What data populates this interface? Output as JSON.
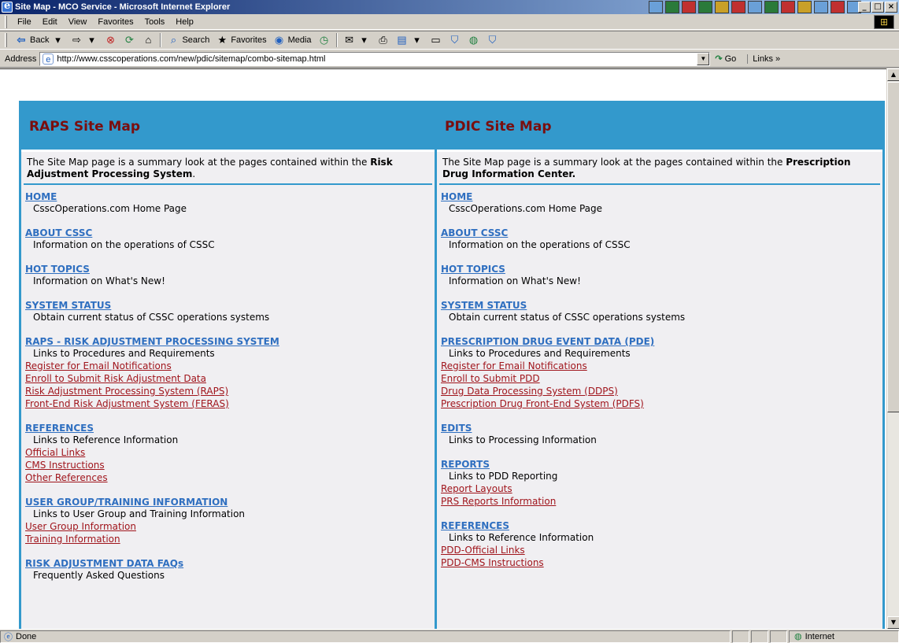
{
  "window": {
    "title": "Site Map - MCO Service - Microsoft Internet Explorer",
    "buttons": [
      "_",
      "□",
      "×"
    ]
  },
  "menu": [
    "File",
    "Edit",
    "View",
    "Favorites",
    "Tools",
    "Help"
  ],
  "toolbar": {
    "back": "Back",
    "search": "Search",
    "favorites": "Favorites",
    "media": "Media"
  },
  "address": {
    "label": "Address",
    "url": "http://www.csscoperations.com/new/pdic/sitemap/combo-sitemap.html",
    "go": "Go",
    "links": "Links"
  },
  "left": {
    "title": "RAPS Site Map",
    "intro_prefix": "The Site Map page is a summary look at the pages contained within the ",
    "intro_bold": "Risk Adjustment Processing System",
    "intro_suffix": ".",
    "sections": [
      {
        "title": "HOME",
        "desc": "CsscOperations.com Home Page",
        "links": []
      },
      {
        "title": "ABOUT CSSC",
        "desc": "Information on the operations of CSSC",
        "links": []
      },
      {
        "title": "HOT TOPICS",
        "desc": "Information on What's New!",
        "links": []
      },
      {
        "title": "SYSTEM STATUS",
        "desc": "Obtain current status of CSSC operations systems",
        "links": []
      },
      {
        "title": "RAPS - RISK ADJUSTMENT PROCESSING SYSTEM",
        "desc": "Links to Procedures and Requirements",
        "links": [
          "Register for Email Notifications",
          "Enroll to Submit Risk Adjustment Data",
          "Risk Adjustment Processing System (RAPS)",
          "Front-End Risk Adjustment System (FERAS)"
        ]
      },
      {
        "title": "REFERENCES",
        "desc": "Links to Reference Information",
        "links": [
          "Official Links",
          "CMS Instructions",
          "Other References"
        ]
      },
      {
        "title": "USER GROUP/TRAINING INFORMATION",
        "desc": "Links to User Group and Training Information",
        "links": [
          "User Group Information",
          "Training Information"
        ]
      },
      {
        "title": "RISK ADJUSTMENT DATA FAQs",
        "desc": "Frequently Asked Questions",
        "links": []
      }
    ]
  },
  "right": {
    "title": "PDIC Site Map",
    "intro_prefix": "The Site Map page is a summary look at the pages contained within the ",
    "intro_bold": "Prescription Drug Information Center.",
    "intro_suffix": "",
    "sections": [
      {
        "title": "HOME",
        "desc": "CsscOperations.com Home Page",
        "links": []
      },
      {
        "title": "ABOUT CSSC",
        "desc": "Information on the operations of CSSC",
        "links": []
      },
      {
        "title": "HOT TOPICS",
        "desc": "Information on What's New!",
        "links": []
      },
      {
        "title": "SYSTEM STATUS",
        "desc": "Obtain current status of CSSC operations systems",
        "links": []
      },
      {
        "title": "PRESCRIPTION DRUG EVENT DATA (PDE)",
        "desc": "Links to Procedures and Requirements",
        "links": [
          "Register for Email Notifications",
          "Enroll to Submit PDD",
          "Drug Data Processing System (DDPS)",
          "Prescription Drug Front-End System (PDFS)"
        ]
      },
      {
        "title": "EDITS",
        "desc": "Links to Processing Information",
        "links": []
      },
      {
        "title": "REPORTS",
        "desc": "Links to PDD Reporting",
        "links": [
          "Report Layouts",
          "PRS Reports Information"
        ]
      },
      {
        "title": "REFERENCES",
        "desc": "Links to Reference Information",
        "links": [
          "PDD-Official Links",
          "PDD-CMS Instructions"
        ]
      }
    ]
  },
  "status": {
    "text": "Done",
    "zone": "Internet"
  }
}
